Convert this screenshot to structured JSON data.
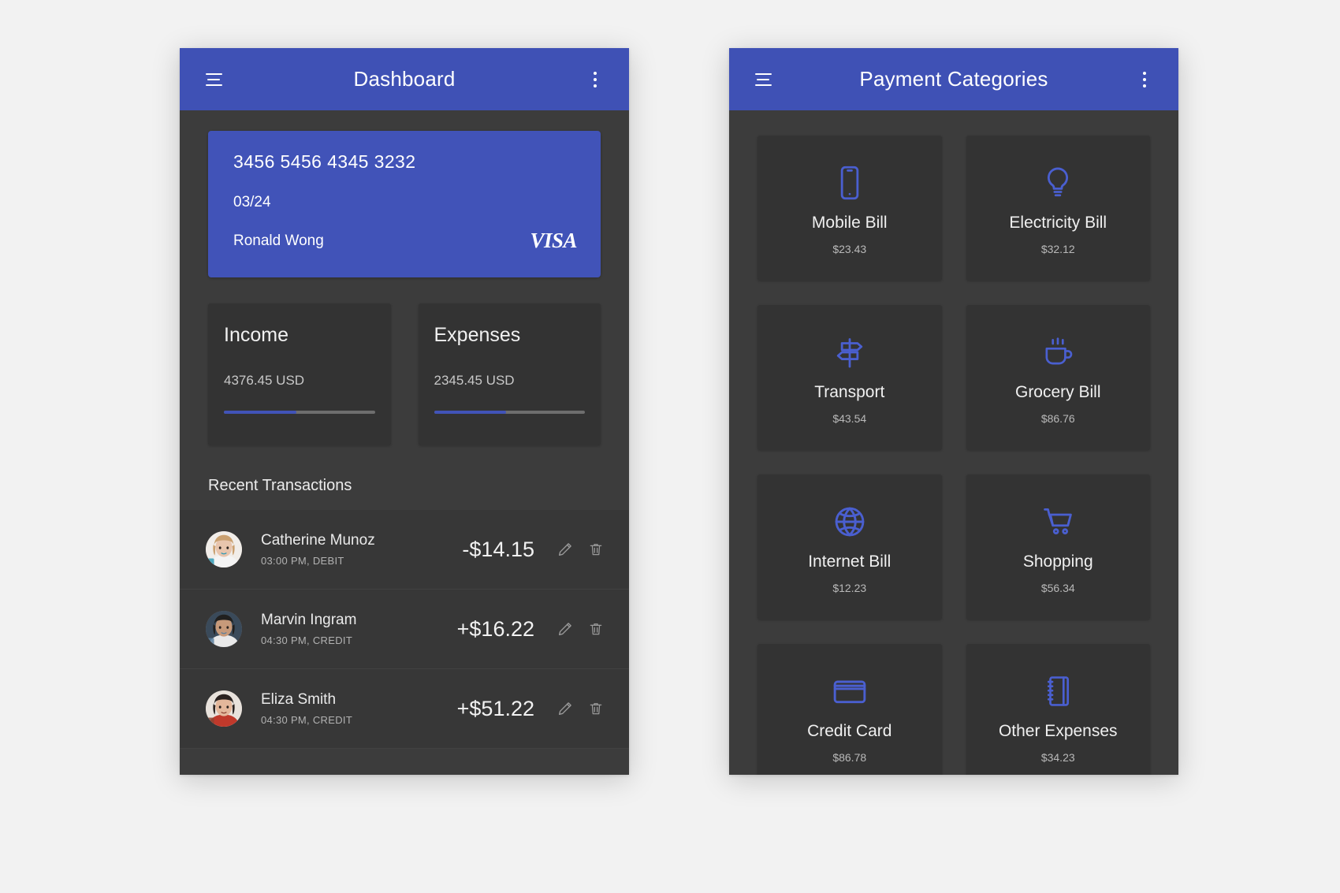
{
  "theme": {
    "accent": "#3f51b5",
    "card_accent": "#4153b8",
    "screen_bg": "#3c3c3c",
    "tile_bg": "#333333",
    "page_bg": "#f2f2f2"
  },
  "left_screen": {
    "appbar": {
      "menu_icon": "hamburger-icon",
      "title": "Dashboard",
      "overflow_icon": "kebab-menu-icon"
    },
    "credit_card": {
      "number": "3456 5456 4345 3232",
      "expiry": "03/24",
      "holder": "Ronald Wong",
      "brand": "VISA"
    },
    "stats": [
      {
        "title": "Income",
        "value": "4376.45 USD",
        "progress": 48
      },
      {
        "title": "Expenses",
        "value": "2345.45 USD",
        "progress": 48
      }
    ],
    "transactions_section": {
      "title": "Recent Transactions",
      "rows": [
        {
          "avatar": "avatar-catherine",
          "name": "Catherine Munoz",
          "meta": "03:00 PM, DEBIT",
          "amount": "-$14.15",
          "edit_icon": "pencil-icon",
          "delete_icon": "trash-icon"
        },
        {
          "avatar": "avatar-marvin",
          "name": "Marvin Ingram",
          "meta": "04:30 PM, CREDIT",
          "amount": "+$16.22",
          "edit_icon": "pencil-icon",
          "delete_icon": "trash-icon"
        },
        {
          "avatar": "avatar-eliza",
          "name": "Eliza Smith",
          "meta": "04:30 PM, CREDIT",
          "amount": "+$51.22",
          "edit_icon": "pencil-icon",
          "delete_icon": "trash-icon"
        }
      ]
    }
  },
  "right_screen": {
    "appbar": {
      "menu_icon": "hamburger-icon",
      "title": "Payment Categories",
      "overflow_icon": "kebab-menu-icon"
    },
    "categories": [
      {
        "icon": "mobile-phone-icon",
        "label": "Mobile Bill",
        "price": "$23.43"
      },
      {
        "icon": "light-bulb-icon",
        "label": "Electricity Bill",
        "price": "$32.12"
      },
      {
        "icon": "signpost-icon",
        "label": "Transport",
        "price": "$43.54"
      },
      {
        "icon": "coffee-cup-icon",
        "label": "Grocery Bill",
        "price": "$86.76"
      },
      {
        "icon": "globe-icon",
        "label": "Internet Bill",
        "price": "$12.23"
      },
      {
        "icon": "shopping-cart-icon",
        "label": "Shopping",
        "price": "$56.34"
      },
      {
        "icon": "credit-card-icon",
        "label": "Credit Card",
        "price": "$86.78"
      },
      {
        "icon": "notebook-icon",
        "label": "Other Expenses",
        "price": "$34.23"
      }
    ]
  }
}
